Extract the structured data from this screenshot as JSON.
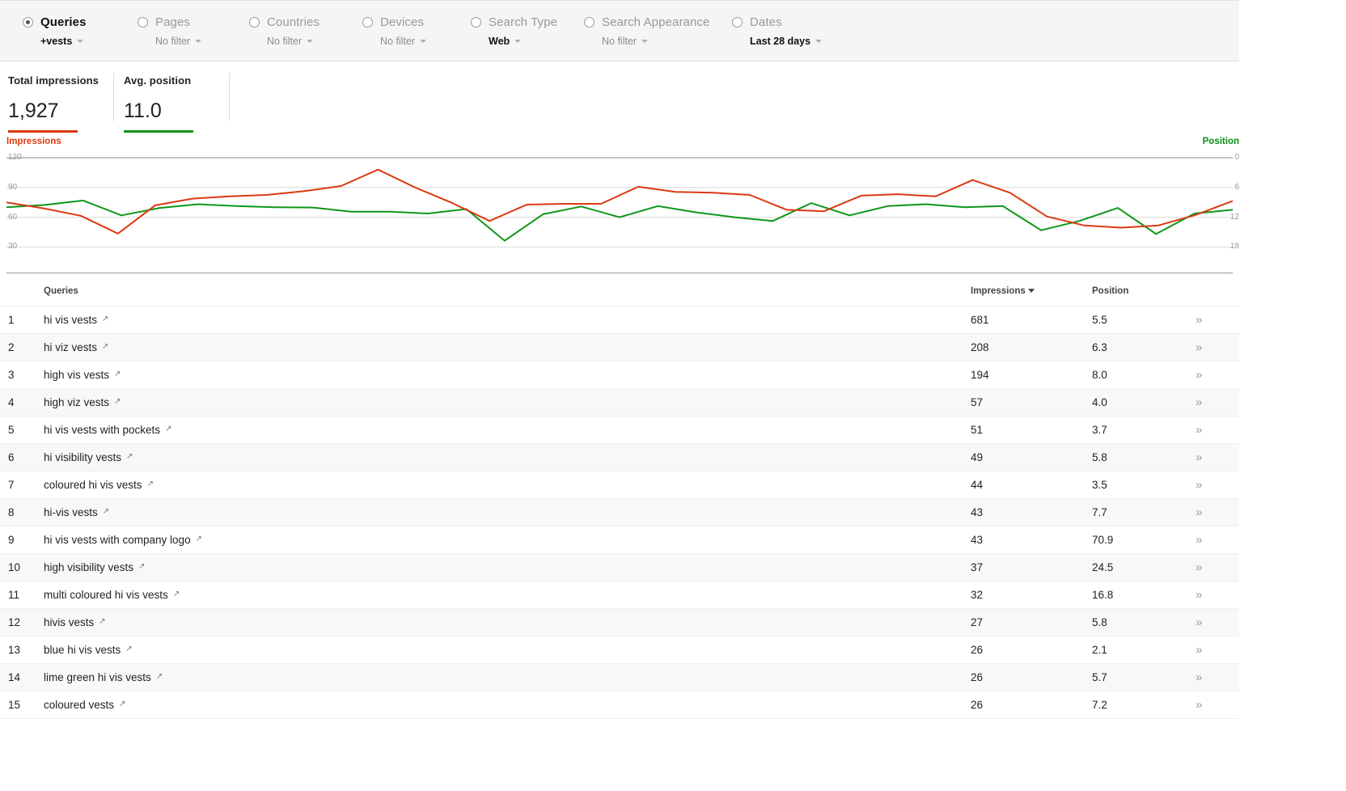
{
  "filters": [
    {
      "name": "queries",
      "label": "Queries",
      "value": "+vests",
      "selected": true,
      "value_bold": true
    },
    {
      "name": "pages",
      "label": "Pages",
      "value": "No filter",
      "selected": false,
      "value_bold": false
    },
    {
      "name": "countries",
      "label": "Countries",
      "value": "No filter",
      "selected": false,
      "value_bold": false
    },
    {
      "name": "devices",
      "label": "Devices",
      "value": "No filter",
      "selected": false,
      "value_bold": false
    },
    {
      "name": "search-type",
      "label": "Search Type",
      "value": "Web",
      "selected": false,
      "value_bold": true
    },
    {
      "name": "search-appearance",
      "label": "Search Appearance",
      "value": "No filter",
      "selected": false,
      "value_bold": false
    },
    {
      "name": "dates",
      "label": "Dates",
      "value": "Last 28 days",
      "selected": false,
      "value_bold": true
    }
  ],
  "metrics": [
    {
      "name": "total-impressions",
      "title": "Total impressions",
      "value": "1,927",
      "color": "#dc3912"
    },
    {
      "name": "avg-position",
      "title": "Avg. position",
      "value": "11.0",
      "color": "#109618"
    }
  ],
  "chart_data": {
    "type": "line",
    "title": "",
    "left_axis_label": "Impressions",
    "right_axis_label": "Position",
    "left_ticks": [
      "120",
      "90",
      "60",
      "30"
    ],
    "right_ticks": [
      "0",
      "6",
      "12",
      "18"
    ],
    "ylim": [
      15,
      135
    ],
    "y2lim": [
      21,
      -3
    ],
    "y2_inverted": true,
    "grid": true,
    "legend": "axis-titles",
    "x": [
      1,
      2,
      3,
      4,
      5,
      6,
      7,
      8,
      9,
      10,
      11,
      12,
      13,
      14,
      15,
      16,
      17,
      18,
      19,
      20,
      21,
      22,
      23,
      24,
      25,
      26,
      27,
      28
    ],
    "series": [
      {
        "name": "Impressions",
        "color": "#dc3912",
        "axis": "left",
        "values": [
          75,
          67,
          57,
          33,
          71,
          80,
          83,
          85,
          90,
          97,
          119,
          95,
          74,
          50,
          72,
          73,
          73,
          96,
          89,
          88,
          85,
          65,
          63,
          84,
          86,
          83,
          105,
          88,
          56,
          44,
          41,
          44,
          58,
          77
        ]
      },
      {
        "name": "Position",
        "color": "#109618",
        "axis": "right",
        "values": [
          10.3,
          9.7,
          8.5,
          12.5,
          10.5,
          9.5,
          10.0,
          10.3,
          10.4,
          11.5,
          11.5,
          12.0,
          10.8,
          19.3,
          12.2,
          10.1,
          13.0,
          10.0,
          11.7,
          13.0,
          14.0,
          9.2,
          12.5,
          10.0,
          9.5,
          10.3,
          10.0,
          16.5,
          14.0,
          10.5,
          17.5,
          12.0,
          11.0
        ]
      }
    ]
  },
  "table": {
    "columns": {
      "rank": "",
      "query": "Queries",
      "impressions": "Impressions",
      "position": "Position",
      "more": ""
    },
    "sorted_by": "impressions",
    "sort_direction": "desc",
    "external_link_icon": "↗",
    "expand_icon": "»",
    "rows": [
      {
        "rank": "1",
        "query": "hi vis vests",
        "impressions": "681",
        "position": "5.5"
      },
      {
        "rank": "2",
        "query": "hi viz vests",
        "impressions": "208",
        "position": "6.3"
      },
      {
        "rank": "3",
        "query": "high vis vests",
        "impressions": "194",
        "position": "8.0"
      },
      {
        "rank": "4",
        "query": "high viz vests",
        "impressions": "57",
        "position": "4.0"
      },
      {
        "rank": "5",
        "query": "hi vis vests with pockets",
        "impressions": "51",
        "position": "3.7"
      },
      {
        "rank": "6",
        "query": "hi visibility vests",
        "impressions": "49",
        "position": "5.8"
      },
      {
        "rank": "7",
        "query": "coloured hi vis vests",
        "impressions": "44",
        "position": "3.5"
      },
      {
        "rank": "8",
        "query": "hi-vis vests",
        "impressions": "43",
        "position": "7.7"
      },
      {
        "rank": "9",
        "query": "hi vis vests with company logo",
        "impressions": "43",
        "position": "70.9"
      },
      {
        "rank": "10",
        "query": "high visibility vests",
        "impressions": "37",
        "position": "24.5"
      },
      {
        "rank": "11",
        "query": "multi coloured hi vis vests",
        "impressions": "32",
        "position": "16.8"
      },
      {
        "rank": "12",
        "query": "hivis vests",
        "impressions": "27",
        "position": "5.8"
      },
      {
        "rank": "13",
        "query": "blue hi vis vests",
        "impressions": "26",
        "position": "2.1"
      },
      {
        "rank": "14",
        "query": "lime green hi vis vests",
        "impressions": "26",
        "position": "5.7"
      },
      {
        "rank": "15",
        "query": "coloured vests",
        "impressions": "26",
        "position": "7.2"
      }
    ]
  }
}
